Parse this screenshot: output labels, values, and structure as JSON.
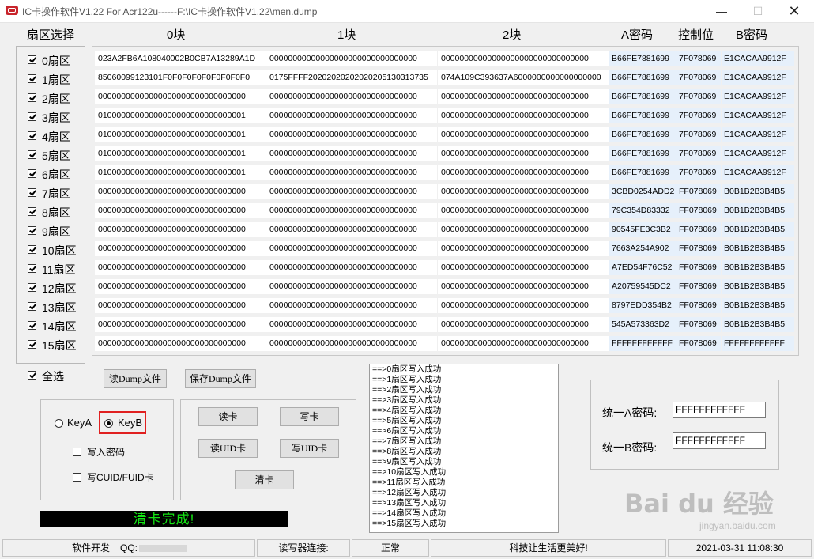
{
  "window": {
    "title": "IC卡操作软件V1.22 For Acr122u------F:\\IC卡操作软件V1.22\\men.dump",
    "min": "—",
    "max": "☐",
    "close": "✕"
  },
  "headers": {
    "sector_select": "扇区选择",
    "block0": "0块",
    "block1": "1块",
    "block2": "2块",
    "key_a": "A密码",
    "control": "控制位",
    "key_b": "B密码"
  },
  "sectors": [
    {
      "label": "0扇区",
      "b0": "023A2FB6A108040002B0CB7A13289A1D",
      "b1": "00000000000000000000000000000000",
      "b2": "00000000000000000000000000000000",
      "ka": "B66FE7881699",
      "ctl": "7F078069",
      "kb": "E1CACAA9912F"
    },
    {
      "label": "1扇区",
      "b0": "85060099123101F0F0F0F0F0F0F0F0F0",
      "b1": "0175FFFF20202020202020205130313735",
      "b2": "074A109C393637A6000000000000000000",
      "ka": "B66FE7881699",
      "ctl": "7F078069",
      "kb": "E1CACAA9912F"
    },
    {
      "label": "2扇区",
      "b0": "00000000000000000000000000000000",
      "b1": "00000000000000000000000000000000",
      "b2": "00000000000000000000000000000000",
      "ka": "B66FE7881699",
      "ctl": "7F078069",
      "kb": "E1CACAA9912F"
    },
    {
      "label": "3扇区",
      "b0": "01000000000000000000000000000001",
      "b1": "00000000000000000000000000000000",
      "b2": "00000000000000000000000000000000",
      "ka": "B66FE7881699",
      "ctl": "7F078069",
      "kb": "E1CACAA9912F"
    },
    {
      "label": "4扇区",
      "b0": "01000000000000000000000000000001",
      "b1": "00000000000000000000000000000000",
      "b2": "00000000000000000000000000000000",
      "ka": "B66FE7881699",
      "ctl": "7F078069",
      "kb": "E1CACAA9912F"
    },
    {
      "label": "5扇区",
      "b0": "01000000000000000000000000000001",
      "b1": "00000000000000000000000000000000",
      "b2": "00000000000000000000000000000000",
      "ka": "B66FE7881699",
      "ctl": "7F078069",
      "kb": "E1CACAA9912F"
    },
    {
      "label": "6扇区",
      "b0": "01000000000000000000000000000001",
      "b1": "00000000000000000000000000000000",
      "b2": "00000000000000000000000000000000",
      "ka": "B66FE7881699",
      "ctl": "7F078069",
      "kb": "E1CACAA9912F"
    },
    {
      "label": "7扇区",
      "b0": "00000000000000000000000000000000",
      "b1": "00000000000000000000000000000000",
      "b2": "00000000000000000000000000000000",
      "ka": "3CBD0254ADD2",
      "ctl": "FF078069",
      "kb": "B0B1B2B3B4B5"
    },
    {
      "label": "8扇区",
      "b0": "00000000000000000000000000000000",
      "b1": "00000000000000000000000000000000",
      "b2": "00000000000000000000000000000000",
      "ka": "79C354D83332",
      "ctl": "FF078069",
      "kb": "B0B1B2B3B4B5"
    },
    {
      "label": "9扇区",
      "b0": "00000000000000000000000000000000",
      "b1": "00000000000000000000000000000000",
      "b2": "00000000000000000000000000000000",
      "ka": "90545FE3C3B2",
      "ctl": "FF078069",
      "kb": "B0B1B2B3B4B5"
    },
    {
      "label": "10扇区",
      "b0": "00000000000000000000000000000000",
      "b1": "00000000000000000000000000000000",
      "b2": "00000000000000000000000000000000",
      "ka": "7663A254A902",
      "ctl": "FF078069",
      "kb": "B0B1B2B3B4B5"
    },
    {
      "label": "11扇区",
      "b0": "00000000000000000000000000000000",
      "b1": "00000000000000000000000000000000",
      "b2": "00000000000000000000000000000000",
      "ka": "A7ED54F76C52",
      "ctl": "FF078069",
      "kb": "B0B1B2B3B4B5"
    },
    {
      "label": "12扇区",
      "b0": "00000000000000000000000000000000",
      "b1": "00000000000000000000000000000000",
      "b2": "00000000000000000000000000000000",
      "ka": "A20759545DC2",
      "ctl": "FF078069",
      "kb": "B0B1B2B3B4B5"
    },
    {
      "label": "13扇区",
      "b0": "00000000000000000000000000000000",
      "b1": "00000000000000000000000000000000",
      "b2": "00000000000000000000000000000000",
      "ka": "8797EDD354B2",
      "ctl": "FF078069",
      "kb": "B0B1B2B3B4B5"
    },
    {
      "label": "14扇区",
      "b0": "00000000000000000000000000000000",
      "b1": "00000000000000000000000000000000",
      "b2": "00000000000000000000000000000000",
      "ka": "545A573363D2",
      "ctl": "FF078069",
      "kb": "B0B1B2B3B4B5"
    },
    {
      "label": "15扇区",
      "b0": "00000000000000000000000000000000",
      "b1": "00000000000000000000000000000000",
      "b2": "00000000000000000000000000000000",
      "ka": "FFFFFFFFFFFF",
      "ctl": "FF078069",
      "kb": "FFFFFFFFFFFF"
    }
  ],
  "controls": {
    "select_all": "全选",
    "read_dump": "读Dump文件",
    "save_dump": "保存Dump文件",
    "key_a": "KeyA",
    "key_b": "KeyB",
    "write_password": "写入密码",
    "write_cuid": "写CUID/FUID卡",
    "read_card": "读卡",
    "write_card": "写卡",
    "read_uid": "读UID卡",
    "write_uid": "写UID卡",
    "clear_card": "清卡",
    "status_msg": "清卡完成!",
    "status_color": "#14e414",
    "highlight_color": "#e02020"
  },
  "log": [
    "==>0扇区写入成功",
    "==>1扇区写入成功",
    "==>2扇区写入成功",
    "==>3扇区写入成功",
    "==>4扇区写入成功",
    "==>5扇区写入成功",
    "==>6扇区写入成功",
    "==>7扇区写入成功",
    "==>8扇区写入成功",
    "==>9扇区写入成功",
    "==>10扇区写入成功",
    "==>11扇区写入成功",
    "==>12扇区写入成功",
    "==>13扇区写入成功",
    "==>14扇区写入成功",
    "==>15扇区写入成功"
  ],
  "unified": {
    "a_label": "统一A密码:",
    "a_value": "FFFFFFFFFFFF",
    "b_label": "统一B密码:",
    "b_value": "FFFFFFFFFFFF"
  },
  "statusbar": {
    "dev": "软件开发",
    "qq": "QQ:",
    "reader_label": "读写器连接:",
    "reader_state": "正常",
    "slogan": "科技让生活更美好!",
    "datetime": "2021-03-31 11:08:30"
  },
  "watermark": {
    "main": "Bai du 经验",
    "sub": "jingyan.baidu.com"
  }
}
